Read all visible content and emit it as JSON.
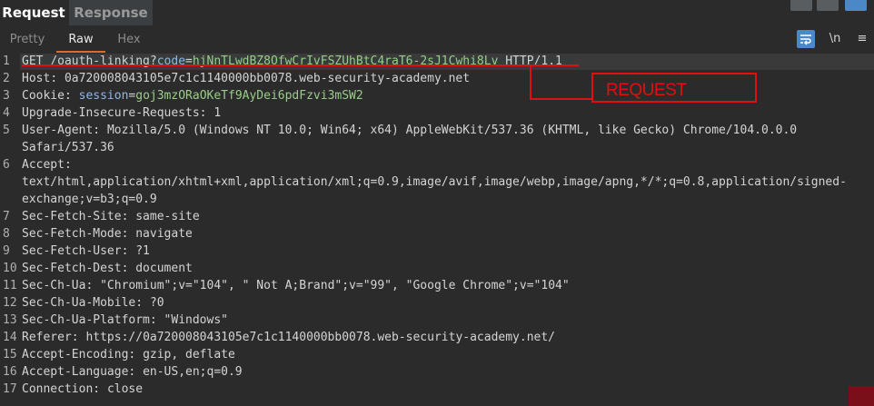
{
  "tabs": {
    "request": "Request",
    "response": "Response"
  },
  "view_tabs": {
    "pretty": "Pretty",
    "raw": "Raw",
    "hex": "Hex",
    "active": "Raw"
  },
  "toolbar": {
    "newline": "\\n",
    "menu": "≡"
  },
  "lines": [
    {
      "n": "1",
      "method": "GET",
      "path": "/oauth-linking?",
      "qkey": "code",
      "qeq": "=",
      "qval": "hjNnTLwdBZ8OfwCrIvFSZUhBtC4raT6-2sJ1Cwhi8Lv",
      "proto": " HTTP/1.1"
    },
    {
      "n": "2",
      "name": "Host",
      "value": "0a720008043105e7c1c1140000bb0078.web-security-academy.net"
    },
    {
      "n": "3",
      "name": "Cookie",
      "ckey": "session",
      "cval": "goj3mzORaOKeTf9AyDei6pdFzvi3mSW2"
    },
    {
      "n": "4",
      "name": "Upgrade-Insecure-Requests",
      "value": "1"
    },
    {
      "n": "5",
      "name": "User-Agent",
      "value": "Mozilla/5.0 (Windows NT 10.0; Win64; x64) AppleWebKit/537.36 (KHTML, like Gecko) Chrome/104.0.0.0",
      "cont": "Safari/537.36"
    },
    {
      "n": "6",
      "name": "Accept",
      "value": "",
      "cont": "text/html,application/xhtml+xml,application/xml;q=0.9,image/avif,image/webp,image/apng,*/*;q=0.8,application/signed-",
      "cont2": "exchange;v=b3;q=0.9"
    },
    {
      "n": "7",
      "name": "Sec-Fetch-Site",
      "value": "same-site"
    },
    {
      "n": "8",
      "name": "Sec-Fetch-Mode",
      "value": "navigate"
    },
    {
      "n": "9",
      "name": "Sec-Fetch-User",
      "value": "?1"
    },
    {
      "n": "10",
      "name": "Sec-Fetch-Dest",
      "value": "document"
    },
    {
      "n": "11",
      "name": "Sec-Ch-Ua",
      "value": "\"Chromium\";v=\"104\", \" Not A;Brand\";v=\"99\", \"Google Chrome\";v=\"104\""
    },
    {
      "n": "12",
      "name": "Sec-Ch-Ua-Mobile",
      "value": "?0"
    },
    {
      "n": "13",
      "name": "Sec-Ch-Ua-Platform",
      "value": "\"Windows\""
    },
    {
      "n": "14",
      "name": "Referer",
      "value": "https://0a720008043105e7c1c1140000bb0078.web-security-academy.net/"
    },
    {
      "n": "15",
      "name": "Accept-Encoding",
      "value": "gzip, deflate"
    },
    {
      "n": "16",
      "name": "Accept-Language",
      "value": "en-US,en;q=0.9"
    },
    {
      "n": "17",
      "name": "Connection",
      "value": "close"
    }
  ],
  "annotation": {
    "label": "REQUEST",
    "color": "#e01010"
  },
  "colors": {
    "background": "#2b2b2b",
    "accent": "#e06a2a",
    "param_key": "#8fb7e6",
    "param_value": "#9acd8a"
  }
}
